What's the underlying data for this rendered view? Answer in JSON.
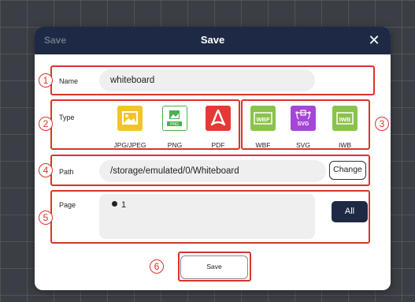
{
  "dialog": {
    "ghost_title": "Save",
    "title": "Save",
    "close_glyph": "✕"
  },
  "name_row": {
    "label": "Name",
    "value": "whiteboard"
  },
  "type_row": {
    "label": "Type",
    "formats": [
      {
        "label": "JPG/JPEG",
        "icon": "image-icon",
        "color": "#f3c42a"
      },
      {
        "label": "PNG",
        "icon": "png-icon",
        "color": "#4caf50"
      },
      {
        "label": "PDF",
        "icon": "pdf-icon",
        "color": "#e53935"
      },
      {
        "label": "WBF",
        "icon": "wbf-icon",
        "color": "#8bc34a",
        "badge": "WBF"
      },
      {
        "label": "SVG",
        "icon": "svg-icon",
        "color": "#a546d6",
        "badge": "SVG"
      },
      {
        "label": "IWB",
        "icon": "iwb-icon",
        "color": "#8bc34a",
        "badge": "IWB"
      }
    ],
    "png_badge": "PNG"
  },
  "path_row": {
    "label": "Path",
    "value": "/storage/emulated/0/Whiteboard",
    "change_button": "Change"
  },
  "page_row": {
    "label": "Page",
    "selected_page": "1",
    "all_button": "All"
  },
  "save_button": "Save",
  "annotations": [
    "1",
    "2",
    "3",
    "4",
    "5",
    "6"
  ],
  "colors": {
    "header": "#1e2a45",
    "annotation": "#d9342b",
    "field_bg": "#efefef"
  }
}
